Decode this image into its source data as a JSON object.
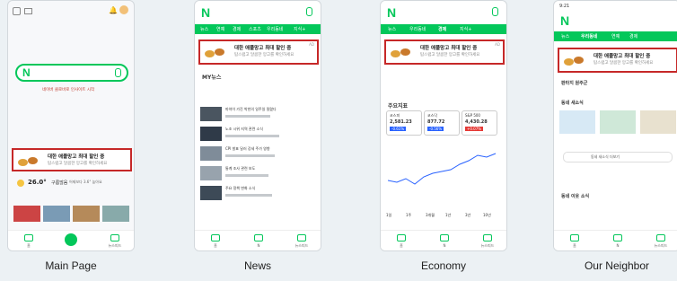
{
  "captions": [
    "Main Page",
    "News",
    "Economy",
    "Our Neighbor"
  ],
  "logo": "N",
  "ad": {
    "line1": "대한 애플망고 최대 할인 중",
    "line2": "탐스럽고 달콤한 망고를 확인하세요",
    "tag": "AD"
  },
  "main": {
    "search_icon": "mic-icon",
    "weather": "26.0°",
    "weather_text": "구름많음",
    "weather_sub": "어제보다 3.6° 높아요",
    "notice": "네이버 클로바로 인사이트 시작"
  },
  "news": {
    "tabs": [
      "뉴스",
      "연예",
      "경제",
      "스포츠",
      "우리동네",
      "지식+"
    ],
    "section": "MY뉴스",
    "headlines": [
      "마약이 가진 박힌의 일주일 밀렸다",
      "노조 시위 지역 관련 소식",
      "CPI 발표 달러 강세 주가 영향",
      "통계 조사 관련 보도",
      "주요 정책 변화 소식"
    ]
  },
  "economy": {
    "tabs": [
      "뉴스",
      "우리동네",
      "경제",
      "지식+"
    ],
    "section": "주요지표",
    "indices": [
      {
        "name": "코스피",
        "value": "2,581.23",
        "change": "-0.61%"
      },
      {
        "name": "코스닥",
        "value": "877.72",
        "change": "-0.56%"
      },
      {
        "name": "S&P 500",
        "value": "4,430.28",
        "change": "+0.07%"
      }
    ],
    "chart_periods": [
      "1일",
      "1주",
      "3개월",
      "1년",
      "3년",
      "10년"
    ]
  },
  "neighbor": {
    "time": "9:21",
    "tabs": [
      "뉴스",
      "우리동네",
      "연예",
      "경제"
    ],
    "location": "판타지 원주군",
    "section": "동네 새소식",
    "section2": "동네 이웃 소식",
    "more": "동네 새소식 더보기"
  },
  "bottom_nav": [
    "홈",
    "N",
    "뉴스피드"
  ]
}
